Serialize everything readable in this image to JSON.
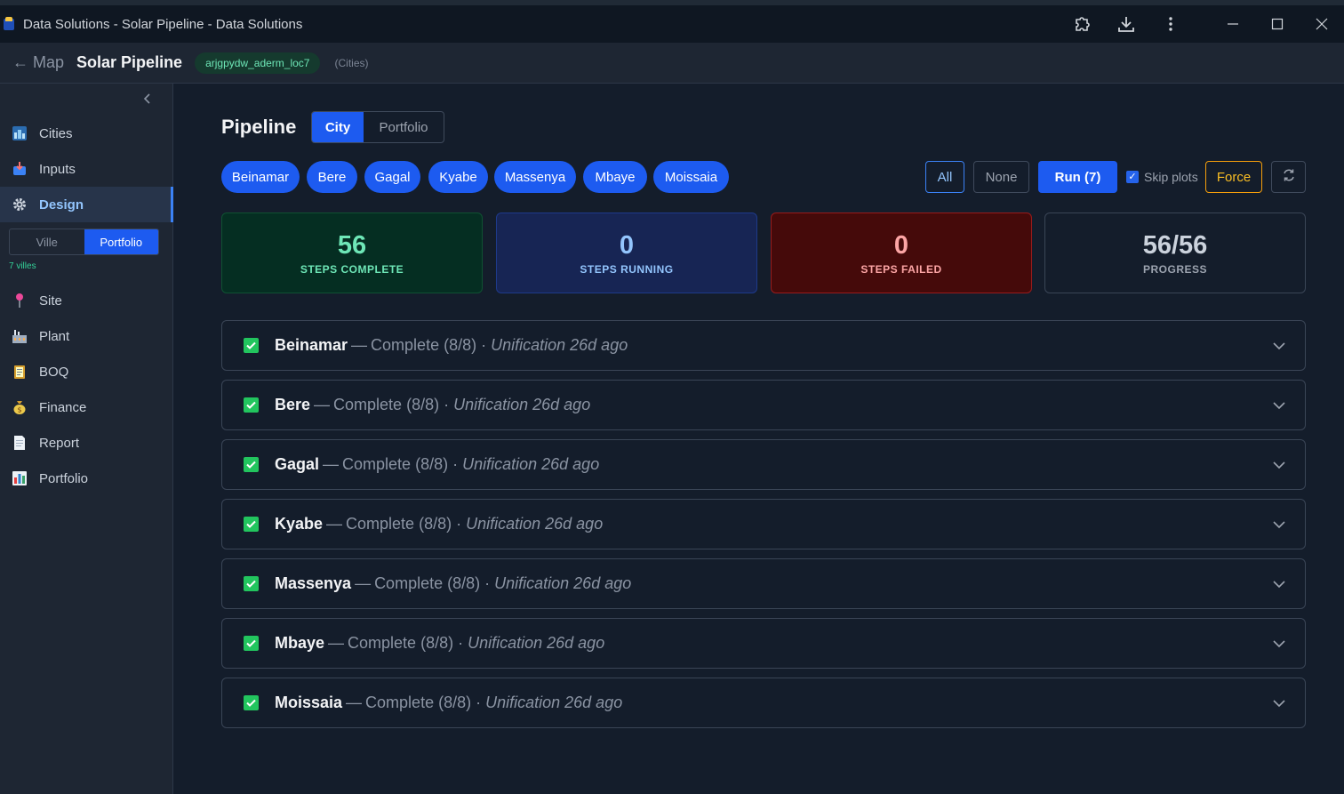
{
  "window": {
    "title": "Data Solutions - Solar Pipeline - Data Solutions"
  },
  "header": {
    "back_label": "← Map",
    "project_title": "Solar Pipeline",
    "tag": "arjgpydw_aderm_loc7",
    "context": "(Cities)"
  },
  "sidebar": {
    "items": [
      {
        "label": "Cities",
        "icon": "cities-icon"
      },
      {
        "label": "Inputs",
        "icon": "inputs-icon"
      },
      {
        "label": "Design",
        "icon": "gear-icon",
        "active": true
      },
      {
        "label": "Site",
        "icon": "pin-icon"
      },
      {
        "label": "Plant",
        "icon": "factory-icon"
      },
      {
        "label": "BOQ",
        "icon": "clipboard-icon"
      },
      {
        "label": "Finance",
        "icon": "money-bag-icon"
      },
      {
        "label": "Report",
        "icon": "document-icon"
      },
      {
        "label": "Portfolio",
        "icon": "bar-chart-icon"
      }
    ],
    "mode_toggle": {
      "left": "Ville",
      "right": "Portfolio",
      "selected": "Portfolio"
    },
    "villes_count": "7 villes"
  },
  "main": {
    "title": "Pipeline",
    "view_toggle": {
      "city": "City",
      "portfolio": "Portfolio",
      "selected": "City"
    },
    "city_chips": [
      "Beinamar",
      "Bere",
      "Gagal",
      "Kyabe",
      "Massenya",
      "Mbaye",
      "Moissaia"
    ],
    "controls": {
      "all": "All",
      "none": "None",
      "run": "Run (7)",
      "skip_plots": "Skip plots",
      "skip_plots_checked": true,
      "force": "Force"
    },
    "stats": [
      {
        "value": "56",
        "label": "STEPS COMPLETE"
      },
      {
        "value": "0",
        "label": "STEPS RUNNING"
      },
      {
        "value": "0",
        "label": "STEPS FAILED"
      },
      {
        "value": "56/56",
        "label": "PROGRESS"
      }
    ],
    "rows": [
      {
        "name": "Beinamar",
        "status": "Complete (8/8)",
        "last": "Unification 26d ago"
      },
      {
        "name": "Bere",
        "status": "Complete (8/8)",
        "last": "Unification 26d ago"
      },
      {
        "name": "Gagal",
        "status": "Complete (8/8)",
        "last": "Unification 26d ago"
      },
      {
        "name": "Kyabe",
        "status": "Complete (8/8)",
        "last": "Unification 26d ago"
      },
      {
        "name": "Massenya",
        "status": "Complete (8/8)",
        "last": "Unification 26d ago"
      },
      {
        "name": "Mbaye",
        "status": "Complete (8/8)",
        "last": "Unification 26d ago"
      },
      {
        "name": "Moissaia",
        "status": "Complete (8/8)",
        "last": "Unification 26d ago"
      }
    ]
  },
  "colors": {
    "accent": "#1d5bf0",
    "success": "#22c55e",
    "warning": "#f59e0b",
    "danger": "#991b1b"
  }
}
